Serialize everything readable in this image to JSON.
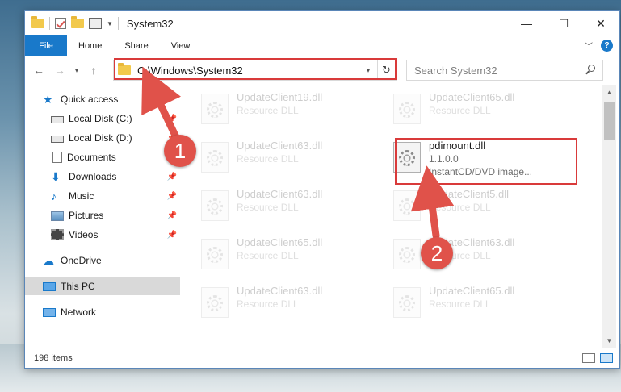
{
  "window": {
    "title": "System32",
    "controls": {
      "minimize": "—",
      "maximize": "☐",
      "close": "✕"
    }
  },
  "ribbon": {
    "tabs": [
      "File",
      "Home",
      "Share",
      "View"
    ],
    "help": "?"
  },
  "navigation": {
    "back": "←",
    "forward": "→",
    "up": "↑",
    "address_path": "C:\\Windows\\System32",
    "search_placeholder": "Search System32"
  },
  "sidebar": {
    "items": [
      {
        "label": "Quick access",
        "icon": "star-icon"
      },
      {
        "label": "Local Disk (C:)",
        "icon": "drive-icon",
        "pinned": true
      },
      {
        "label": "Local Disk (D:)",
        "icon": "drive-icon",
        "pinned": true
      },
      {
        "label": "Documents",
        "icon": "documents-icon",
        "pinned": true
      },
      {
        "label": "Downloads",
        "icon": "download-icon",
        "pinned": true
      },
      {
        "label": "Music",
        "icon": "music-icon",
        "pinned": true
      },
      {
        "label": "Pictures",
        "icon": "pictures-icon",
        "pinned": true
      },
      {
        "label": "Videos",
        "icon": "videos-icon",
        "pinned": true
      },
      {
        "label": "OneDrive",
        "icon": "cloud-icon"
      },
      {
        "label": "This PC",
        "icon": "pc-icon",
        "selected": true
      },
      {
        "label": "Network",
        "icon": "network-icon"
      }
    ]
  },
  "files": [
    {
      "name": "UpdateClient19.dll",
      "type": "Resource DLL",
      "faded": true
    },
    {
      "name": "UpdateClient65.dll",
      "type": "Resource DLL",
      "faded": true
    },
    {
      "name": "UpdateClient63.dll",
      "type": "Resource DLL",
      "faded": true
    },
    {
      "name": "pdimount.dll",
      "version": "1.1.0.0",
      "description": "InstantCD/DVD image...",
      "faded": false
    },
    {
      "name": "UpdateClient63.dll",
      "type": "Resource DLL",
      "faded": true
    },
    {
      "name": "UpdateClient5.dll",
      "type": "Resource DLL",
      "faded": true
    },
    {
      "name": "UpdateClient65.dll",
      "type": "Resource DLL",
      "faded": true
    },
    {
      "name": "UpdateClient63.dll",
      "type": "Resource DLL",
      "faded": true
    },
    {
      "name": "UpdateClient63.dll",
      "type": "Resource DLL",
      "faded": true
    },
    {
      "name": "UpdateClient65.dll",
      "type": "Resource DLL",
      "faded": true
    }
  ],
  "status": {
    "item_count": "198 items"
  },
  "annotations": {
    "step1": "1",
    "step2": "2",
    "color": "#e0524a"
  }
}
